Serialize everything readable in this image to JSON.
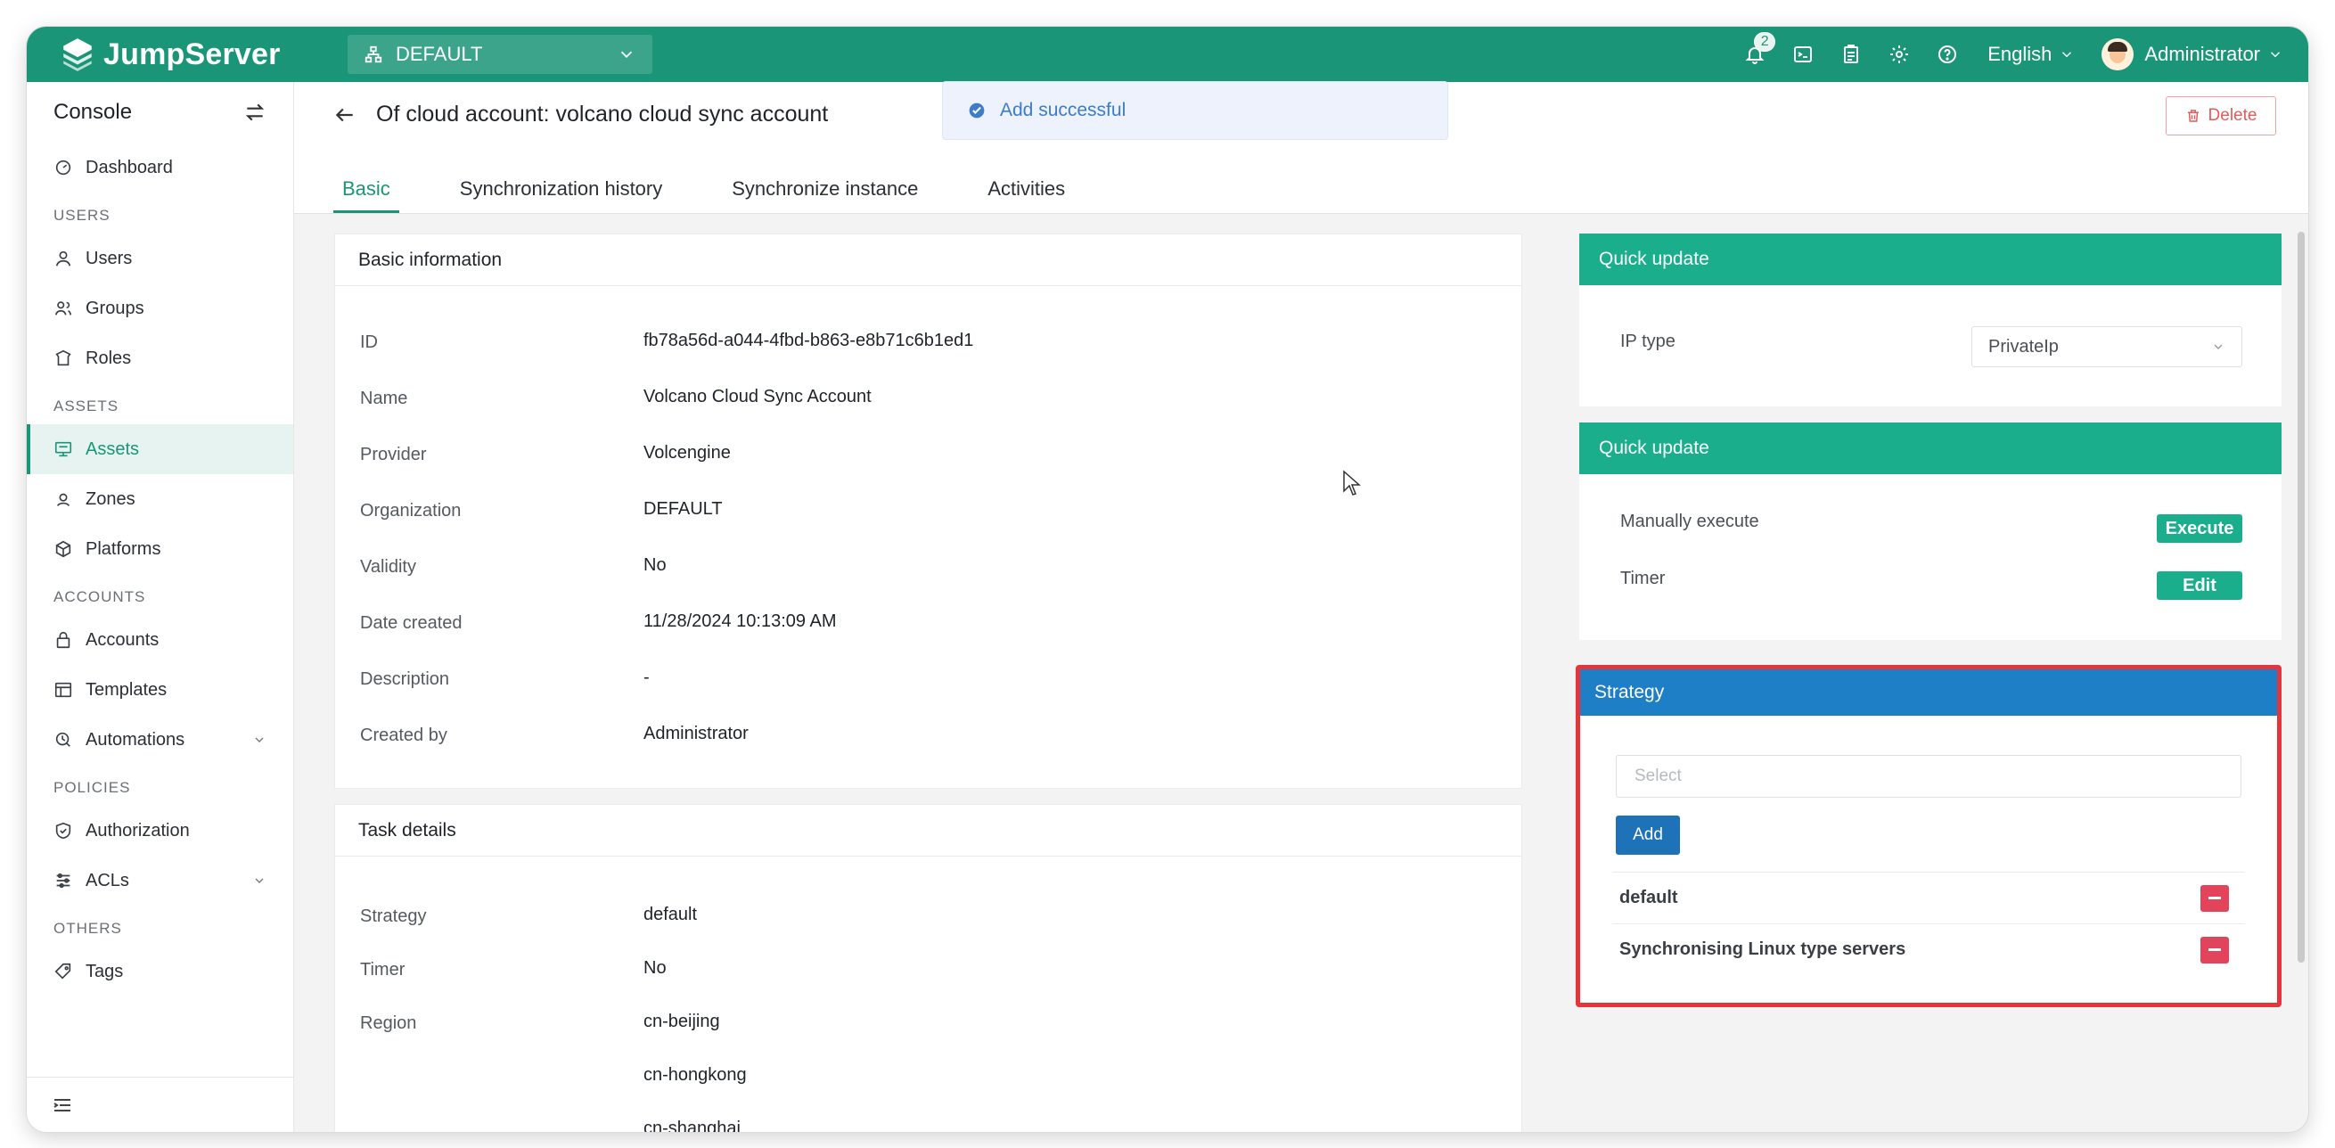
{
  "brand": {
    "name": "JumpServer"
  },
  "org_selector": {
    "value": "DEFAULT"
  },
  "header": {
    "notification_count": "2",
    "language": "English",
    "user": "Administrator"
  },
  "toast": {
    "message": "Add successful"
  },
  "sidebar": {
    "title": "Console",
    "items": [
      {
        "type": "item",
        "label": "Dashboard",
        "icon": "dashboard-icon"
      },
      {
        "type": "group",
        "label": "USERS"
      },
      {
        "type": "item",
        "label": "Users",
        "icon": "user-icon"
      },
      {
        "type": "item",
        "label": "Groups",
        "icon": "groups-icon"
      },
      {
        "type": "item",
        "label": "Roles",
        "icon": "roles-icon"
      },
      {
        "type": "group",
        "label": "ASSETS"
      },
      {
        "type": "item",
        "label": "Assets",
        "icon": "assets-icon",
        "active": true
      },
      {
        "type": "item",
        "label": "Zones",
        "icon": "zones-icon"
      },
      {
        "type": "item",
        "label": "Platforms",
        "icon": "platforms-icon"
      },
      {
        "type": "group",
        "label": "ACCOUNTS"
      },
      {
        "type": "item",
        "label": "Accounts",
        "icon": "lock-icon"
      },
      {
        "type": "item",
        "label": "Templates",
        "icon": "templates-icon"
      },
      {
        "type": "item",
        "label": "Automations",
        "icon": "automations-icon",
        "expandable": true
      },
      {
        "type": "group",
        "label": "POLICIES"
      },
      {
        "type": "item",
        "label": "Authorization",
        "icon": "shield-icon"
      },
      {
        "type": "item",
        "label": "ACLs",
        "icon": "acls-icon",
        "expandable": true
      },
      {
        "type": "group",
        "label": "OTHERS"
      },
      {
        "type": "item",
        "label": "Tags",
        "icon": "tag-icon"
      }
    ]
  },
  "page": {
    "title": "Of cloud account: volcano cloud sync account",
    "delete_label": "Delete",
    "tabs": [
      "Basic",
      "Synchronization history",
      "Synchronize instance",
      "Activities"
    ],
    "active_tab": 0
  },
  "basic_info": {
    "title": "Basic information",
    "rows": [
      {
        "label": "ID",
        "value": "fb78a56d-a044-4fbd-b863-e8b71c6b1ed1"
      },
      {
        "label": "Name",
        "value": "Volcano Cloud Sync Account"
      },
      {
        "label": "Provider",
        "value": "Volcengine"
      },
      {
        "label": "Organization",
        "value": "DEFAULT"
      },
      {
        "label": "Validity",
        "value": "No"
      },
      {
        "label": "Date created",
        "value": "11/28/2024 10:13:09 AM"
      },
      {
        "label": "Description",
        "value": "-"
      },
      {
        "label": "Created by",
        "value": "Administrator"
      }
    ]
  },
  "task_details": {
    "title": "Task details",
    "rows": [
      {
        "label": "Strategy",
        "value": "default"
      },
      {
        "label": "Timer",
        "value": "No"
      },
      {
        "label": "Region",
        "value": "cn-beijing"
      },
      {
        "label": "",
        "value": "cn-hongkong"
      },
      {
        "label": "",
        "value": "cn-shanghai"
      }
    ]
  },
  "quick_update_1": {
    "title": "Quick update",
    "ip_type_label": "IP type",
    "ip_type_value": "PrivateIp"
  },
  "quick_update_2": {
    "title": "Quick update",
    "manual_label": "Manually execute",
    "execute_label": "Execute",
    "timer_label": "Timer",
    "edit_label": "Edit"
  },
  "strategy": {
    "title": "Strategy",
    "select_placeholder": "Select",
    "add_label": "Add",
    "items": [
      "default",
      "Synchronising Linux type servers"
    ]
  },
  "colors": {
    "topbar": "#1b9577",
    "quick_update_header": "#1bae8d",
    "strategy_header": "#1e7ec6",
    "highlight_border": "#e5353b",
    "remove_button": "#e2445c"
  }
}
